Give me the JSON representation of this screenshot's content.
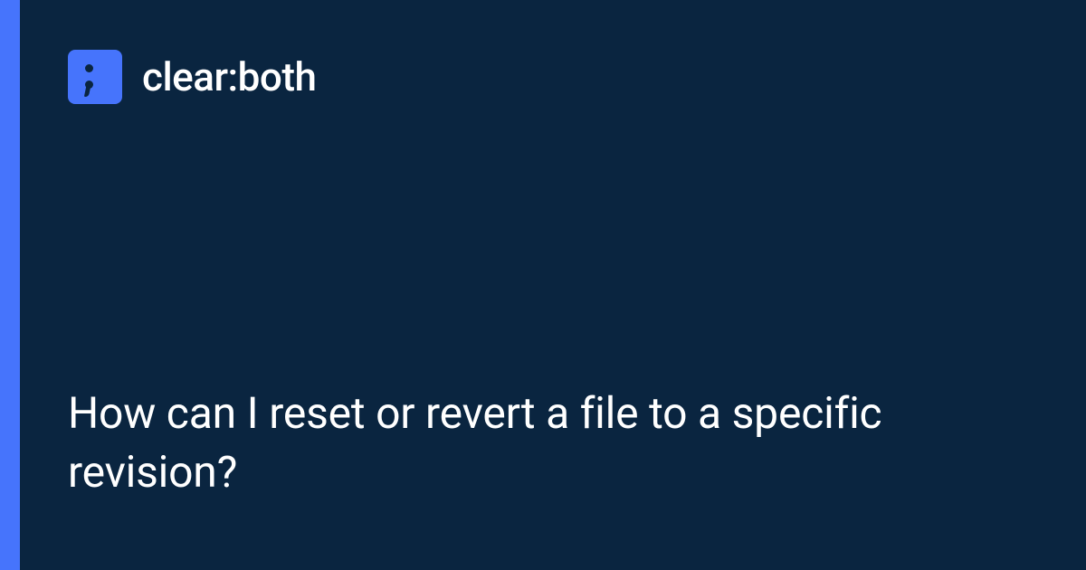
{
  "brand": {
    "name": "clear:both"
  },
  "title": "How can I reset or revert a file to a specific revision?",
  "colors": {
    "background": "#0a2540",
    "accent": "#4674fc",
    "text": "#ffffff"
  }
}
